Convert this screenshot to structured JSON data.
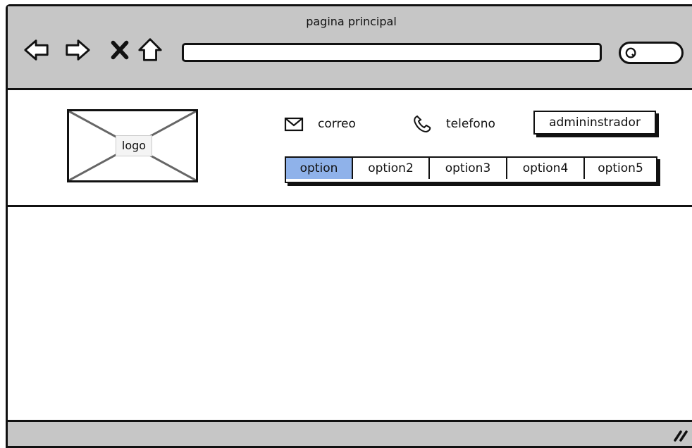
{
  "window": {
    "title": "pagina principal"
  },
  "toolbar": {
    "icons": [
      "back-arrow-icon",
      "forward-arrow-icon",
      "close-x-icon",
      "home-icon",
      "search-icon"
    ],
    "url_value": "",
    "search_value": ""
  },
  "header": {
    "logo_label": "logo",
    "email_label": "correo",
    "phone_label": "telefono",
    "admin_button": "admininstrador"
  },
  "tabs": [
    {
      "label": "option",
      "active": true
    },
    {
      "label": "option2",
      "active": false
    },
    {
      "label": "option3",
      "active": false
    },
    {
      "label": "option4",
      "active": false
    },
    {
      "label": "option5",
      "active": false
    }
  ],
  "colors": {
    "chrome": "#c6c6c6",
    "active_tab": "#8fb2ea",
    "border": "#111111"
  }
}
